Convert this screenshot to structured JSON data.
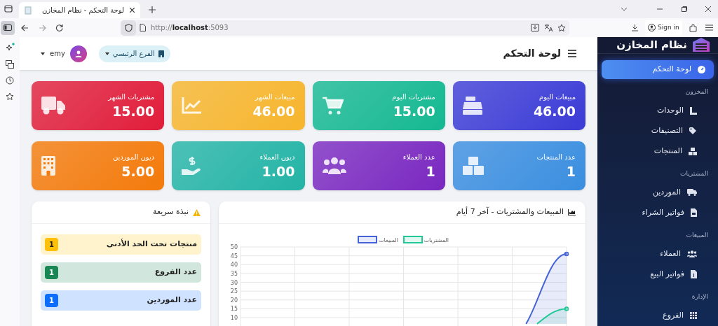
{
  "browser": {
    "tab_title": "لوحة التحكم - نظام المخازن",
    "url_prefix": "http://",
    "url_host": "localhost",
    "url_port": ":5093",
    "sign_in": "Sign in"
  },
  "sidebar": {
    "brand": "نظام المخازن",
    "items": [
      {
        "kind": "link",
        "label": "لوحة التحكم",
        "selected": true
      },
      {
        "kind": "heading",
        "label": "المخزون"
      },
      {
        "kind": "link",
        "label": "الوحدات",
        "selected": false
      },
      {
        "kind": "link",
        "label": "التصنيفات",
        "selected": false
      },
      {
        "kind": "link",
        "label": "المنتجات",
        "selected": false
      },
      {
        "kind": "heading",
        "label": "المشتريات"
      },
      {
        "kind": "link",
        "label": "الموردين",
        "selected": false
      },
      {
        "kind": "link",
        "label": "فواتير الشراء",
        "selected": false
      },
      {
        "kind": "heading",
        "label": "المبيعات"
      },
      {
        "kind": "link",
        "label": "العملاء",
        "selected": false
      },
      {
        "kind": "link",
        "label": "فواتير البيع",
        "selected": false
      },
      {
        "kind": "heading",
        "label": "الإدارة"
      },
      {
        "kind": "link",
        "label": "الفروع",
        "selected": false
      }
    ]
  },
  "header": {
    "title": "لوحة التحكم",
    "branch": "الفرع الرئيسي",
    "user": "emy"
  },
  "stats": [
    {
      "label": "مبيعات اليوم",
      "value": "46.00",
      "color": "#3b3bd6"
    },
    {
      "label": "مشتريات اليوم",
      "value": "15.00",
      "color": "#14b892"
    },
    {
      "label": "مبيعات الشهر",
      "value": "46.00",
      "color": "#f7b52c"
    },
    {
      "label": "مشتريات الشهر",
      "value": "15.00",
      "color": "#e11d3a"
    },
    {
      "label": "عدد المنتجات",
      "value": "1",
      "color": "#3a8ee0"
    },
    {
      "label": "عدد العملاء",
      "value": "1",
      "color": "#7a28c0"
    },
    {
      "label": "ديون العملاء",
      "value": "1.00",
      "color": "#23b4a6"
    },
    {
      "label": "ديون الموردين",
      "value": "5.00",
      "color": "#f47a0a"
    }
  ],
  "chart_panel": {
    "title": "المبيعات والمشتريات - آخر 7 أيام",
    "y_tick_labels": [
      "50",
      "45",
      "40",
      "35",
      "30",
      "25",
      "20",
      "15",
      "10"
    ],
    "legend": [
      {
        "label": "المشتريات",
        "color": "#20c997"
      },
      {
        "label": "المبيعات",
        "color": "#4461d8"
      }
    ]
  },
  "quick_panel": {
    "title": "نبذة سريعة",
    "items": [
      {
        "label": "منتجات تحت الحد الأدنى",
        "count": "1",
        "color": "#ffc107"
      },
      {
        "label": "عدد الفروع",
        "count": "1",
        "color": "#198754"
      },
      {
        "label": "عدد الموردين",
        "count": "1",
        "color": "#0d6efd"
      }
    ]
  }
}
